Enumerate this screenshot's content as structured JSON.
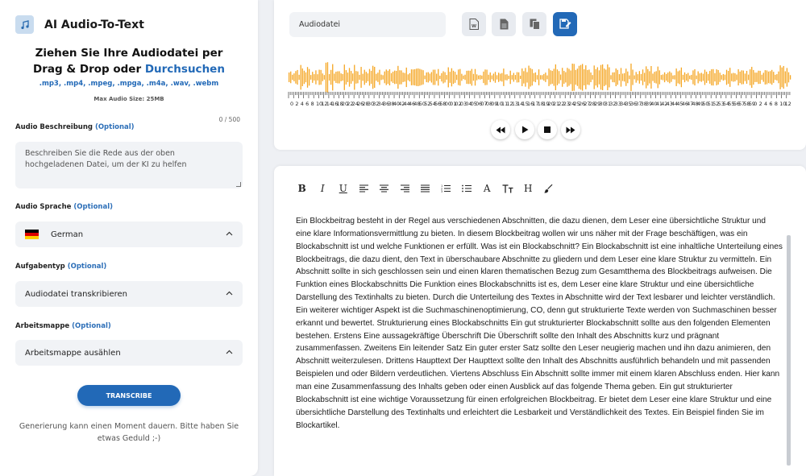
{
  "app": {
    "title": "AI Audio-To-Text",
    "logo_icon": "music-file-icon"
  },
  "upload": {
    "drop_text": "Ziehen Sie Ihre Audiodatei per Drag & Drop oder",
    "browse_link": "Durchsuchen",
    "formats": ".mp3, .mp4, .mpeg, .mpga, .m4a, .wav, .webm",
    "max_size": "Max Audio Size: 25MB"
  },
  "description": {
    "label": "Audio Beschreibung",
    "optional": "(Optional)",
    "counter": "0 / 500",
    "placeholder": "Beschreiben Sie die Rede aus der oben hochgeladenen Datei, um der KI zu helfen"
  },
  "language": {
    "label": "Audio Sprache",
    "optional": "(Optional)",
    "value": "German",
    "flag_colors": [
      "#000000",
      "#dd0000",
      "#ffce00"
    ]
  },
  "task": {
    "label": "Aufgabentyp",
    "optional": "(Optional)",
    "value": "Audiodatei transkribieren"
  },
  "workbook": {
    "label": "Arbeitsmappe",
    "optional": "(Optional)",
    "value": "Arbeitsmappe ausählen"
  },
  "transcribe_button": "TRANSCRIBE",
  "note": "Generierung kann einen Moment dauern. Bitte haben Sie etwas Geduld ;-)",
  "player": {
    "file_name": "Audiodatei",
    "toolbar_icons": [
      "word-export-icon",
      "document-export-icon",
      "copy-icon",
      "save-icon"
    ],
    "waveform_color": "#f5a623",
    "timeline_labels": [
      "0",
      "2",
      "4",
      "6",
      "8",
      "10",
      "12",
      "14",
      "16",
      "18",
      "20",
      "22",
      "24",
      "26",
      "28",
      "30",
      "32",
      "34",
      "36",
      "38",
      "40",
      "42",
      "44",
      "46",
      "48",
      "50",
      "52",
      "54",
      "56",
      "58",
      "00",
      "01",
      "02",
      "03",
      "04",
      "05",
      "06",
      "07",
      "08",
      "09",
      "10",
      "11",
      "12",
      "13",
      "14",
      "15",
      "16",
      "17",
      "18",
      "19",
      "20",
      "21",
      "22",
      "23",
      "24",
      "25",
      "26",
      "27",
      "28",
      "29",
      "30",
      "31",
      "32",
      "33",
      "34",
      "35",
      "36",
      "37",
      "38",
      "39",
      "40",
      "41",
      "42",
      "43",
      "44",
      "45",
      "46",
      "47",
      "48",
      "49",
      "50",
      "51",
      "52",
      "53",
      "54",
      "55",
      "56",
      "57",
      "58",
      "59",
      "0",
      "2",
      "4",
      "6",
      "8",
      "10",
      "12"
    ],
    "controls": [
      "rewind-icon",
      "play-icon",
      "stop-icon",
      "fast-forward-icon"
    ]
  },
  "editor": {
    "toolbar": [
      "B",
      "I",
      "U",
      "align-left-icon",
      "align-center-icon",
      "align-right-icon",
      "align-justify-icon",
      "ordered-list-icon",
      "bullet-list-icon",
      "A",
      "text-size-icon",
      "H",
      "brush-icon"
    ],
    "content": "Ein Blockbeitrag besteht in der Regel aus verschiedenen Abschnitten, die dazu dienen, dem Leser eine übersichtliche Struktur und eine klare Informationsvermittlung zu bieten. In diesem Blockbeitrag wollen wir uns näher mit der Frage beschäftigen, was ein Blockabschnitt ist und welche Funktionen er erfüllt. Was ist ein Blockabschnitt? Ein Blockabschnitt ist eine inhaltliche Unterteilung eines Blockbeitrags, die dazu dient, den Text in überschaubare Abschnitte zu gliedern und dem Leser eine klare Struktur zu vermitteln. Ein Abschnitt sollte in sich geschlossen sein und einen klaren thematischen Bezug zum Gesamtthema des Blockbeitrags aufweisen. Die Funktion eines Blockabschnitts Die Funktion eines Blockabschnitts ist es, dem Leser eine klare Struktur und eine übersichtliche Darstellung des Textinhalts zu bieten. Durch die Unterteilung des Textes in Abschnitte wird der Text lesbarer und leichter verständlich. Ein weiterer wichtiger Aspekt ist die Suchmaschinenoptimierung, CO, denn gut strukturierte Texte werden von Suchmaschinen besser erkannt und bewertet. Strukturierung eines Blockabschnitts Ein gut strukturierter Blockabschnitt sollte aus den folgenden Elementen bestehen. Erstens Eine aussagekräftige Überschrift Die Überschrift sollte den Inhalt des Abschnitts kurz und prägnant zusammenfassen. Zweitens Ein leitender Satz Ein guter erster Satz sollte den Leser neugierig machen und ihn dazu animieren, den Abschnitt weiterzulesen. Drittens Haupttext Der Haupttext sollte den Inhalt des Abschnitts ausführlich behandeln und mit passenden Beispielen und oder Bildern verdeutlichen. Viertens Abschluss Ein Abschnitt sollte immer mit einem klaren Abschluss enden. Hier kann man eine Zusammenfassung des Inhalts geben oder einen Ausblick auf das folgende Thema geben. Ein gut strukturierter Blockabschnitt ist eine wichtige Voraussetzung für einen erfolgreichen Blockbeitrag. Er bietet dem Leser eine klare Struktur und eine übersichtliche Darstellung des Textinhalts und erleichtert die Lesbarkeit und Verständlichkeit des Textes. Ein Beispiel finden Sie im Blockartikel."
  }
}
